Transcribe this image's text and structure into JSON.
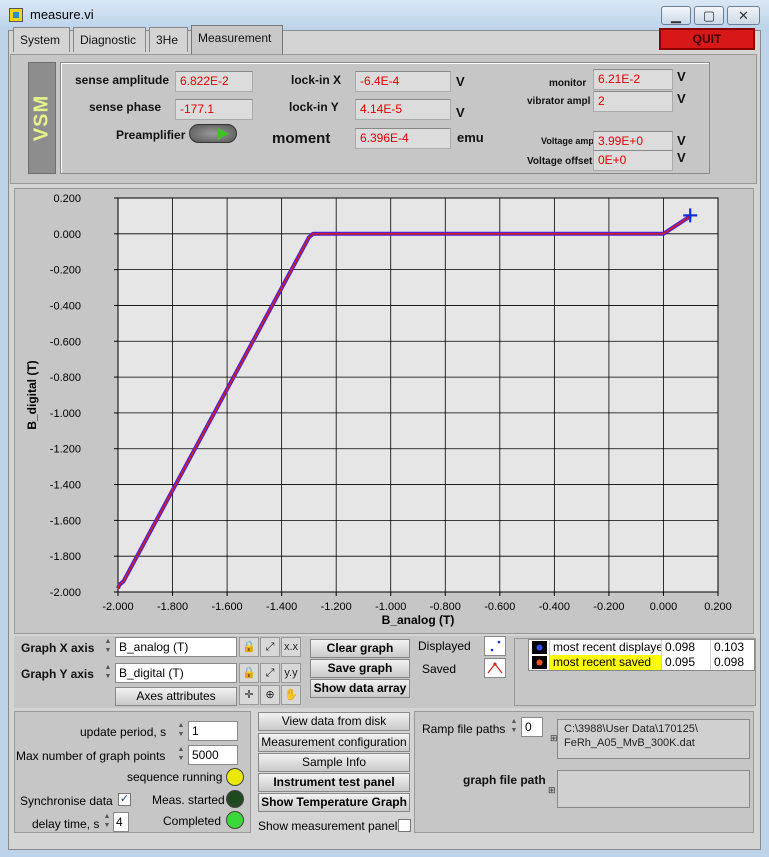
{
  "window": {
    "title": "measure.vi",
    "minimize": "▁",
    "maximize": "▢",
    "close": "✕"
  },
  "tabs": [
    "System",
    "Diagnostic",
    "3He",
    "Measurement"
  ],
  "active_tab": "Measurement",
  "quit_label": "QUIT",
  "vsm": {
    "logo": "VSM",
    "sense_amplitude": {
      "label": "sense amplitude",
      "value": "6.822E-2"
    },
    "sense_phase": {
      "label": "sense phase",
      "value": "-177.1"
    },
    "preamplifier": {
      "label": "Preamplifier"
    },
    "lockin_x": {
      "label": "lock-in X",
      "value": "-6.4E-4",
      "unit": "V"
    },
    "lockin_y": {
      "label": "lock-in Y",
      "value": "4.14E-5",
      "unit": "V"
    },
    "moment": {
      "label": "moment",
      "value": "6.396E-4",
      "unit": "emu"
    },
    "monitor": {
      "label": "monitor",
      "value": "6.21E-2",
      "unit": "V"
    },
    "vibrator_ampl": {
      "label": "vibrator ampl",
      "value": "2",
      "unit": "V"
    },
    "voltage_ampl": {
      "label": "Voltage ampl",
      "value": "3.99E+0",
      "unit": "V"
    },
    "voltage_offset": {
      "label": "Voltage offset",
      "value": "0E+0",
      "unit": "V"
    }
  },
  "chart_data": {
    "type": "line",
    "xlabel": "B_analog (T)",
    "ylabel": "B_digital (T)",
    "xlim": [
      -2.0,
      0.2
    ],
    "ylim": [
      -2.0,
      0.2
    ],
    "x_ticks": [
      "-2.000",
      "-1.800",
      "-1.600",
      "-1.400",
      "-1.200",
      "-1.000",
      "-0.800",
      "-0.600",
      "-0.400",
      "-0.200",
      "0.000",
      "0.200"
    ],
    "y_ticks": [
      "0.200",
      "0.000",
      "-0.200",
      "-0.400",
      "-0.600",
      "-0.800",
      "-1.000",
      "-1.200",
      "-1.400",
      "-1.600",
      "-1.800",
      "-2.000"
    ],
    "grid": true,
    "series": [
      {
        "color": "#5020d8",
        "x": [
          -2.0,
          -1.995,
          -1.98,
          -1.3,
          -1.285,
          0.0,
          0.02,
          0.1
        ],
        "y": [
          -1.98,
          -1.96,
          -1.94,
          -0.02,
          0.0,
          0.0,
          0.02,
          0.1
        ]
      },
      {
        "color": "#d02020",
        "x": [
          -2.0,
          -1.995,
          -1.98,
          -1.3,
          -1.285,
          0.0,
          0.02,
          0.1
        ],
        "y": [
          -1.98,
          -1.96,
          -1.94,
          -0.02,
          0.0,
          0.0,
          0.02,
          0.1
        ]
      }
    ],
    "cursor": {
      "x": 0.098,
      "y": 0.103,
      "color": "#1030e0"
    }
  },
  "graph_controls": {
    "x_axis_label": "Graph X axis",
    "x_axis_value": "B_analog (T)",
    "y_axis_label": "Graph Y axis",
    "y_axis_value": "B_digital (T)",
    "axes_attributes": "Axes attributes",
    "clear_graph": "Clear graph",
    "save_graph": "Save graph",
    "show_data_array": "Show data array",
    "displayed_label": "Displayed",
    "saved_label": "Saved"
  },
  "legend": [
    {
      "name": "most recent displayed",
      "x": "0.098",
      "y": "0.103",
      "highlight": ""
    },
    {
      "name": "most recent saved",
      "x": "0.095",
      "y": "0.098",
      "highlight": "#ffff00"
    }
  ],
  "bottom_left": {
    "update_period_label": "update period, s",
    "update_period": "1",
    "max_points_label": "Max number of graph points",
    "max_points": "5000",
    "sequence_running_label": "sequence running",
    "synchronise_label": "Synchronise data",
    "synchronise_checked": "✓",
    "meas_started_label": "Meas. started",
    "delay_label": "delay time, s",
    "delay": "4",
    "completed_label": "Completed"
  },
  "buttons_mid": {
    "view_data": "View data from disk",
    "measurement_config": "Measurement configuration",
    "sample_info": "Sample Info",
    "instrument_test": "Instrument test panel",
    "show_temperature": "Show Temperature Graph",
    "show_measurement_panel": "Show measurement panel"
  },
  "ramp": {
    "label": "Ramp file paths",
    "index": "0",
    "path_line1": "C:\\3988\\User Data\\170125\\",
    "path_line2": "FeRh_A05_MvB_300K.dat",
    "graph_file_path_label": "graph file path",
    "graph_file_path": ""
  },
  "colors": {
    "led_sequence_running": "#e8e800",
    "led_meas_started": "#1f4a1f",
    "led_completed": "#3bd83b",
    "value_text": "#e00000",
    "quit_bg": "#d81818"
  }
}
